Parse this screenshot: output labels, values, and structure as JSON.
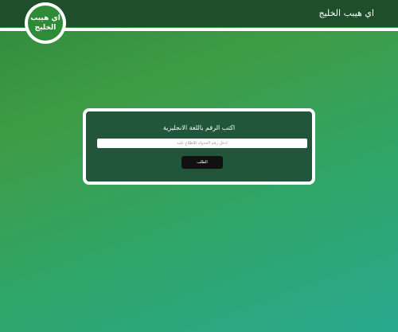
{
  "header": {
    "site_title": "اي هيبب الخليج",
    "logo_line1": "اي هيبب",
    "logo_line2": "الخليج"
  },
  "form": {
    "title": "اكتب الرقم باللغة الانجليزية",
    "input_placeholder": "ادخل رقم الجدولة للاطلاع عليه",
    "input_value": "",
    "submit_label": "الطلب"
  },
  "colors": {
    "topbar": "#1e4e2a",
    "card_background": "#21563a",
    "logo_green": "#2e8b36",
    "button": "#111111"
  }
}
